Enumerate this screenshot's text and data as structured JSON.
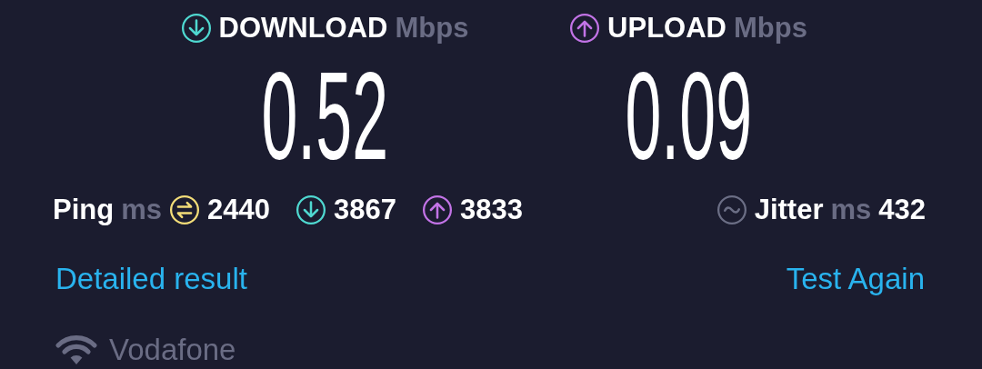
{
  "speeds": [
    {
      "kind": "download",
      "label": "DOWNLOAD",
      "unit": "Mbps",
      "value": "0.52"
    },
    {
      "kind": "upload",
      "label": "UPLOAD",
      "unit": "Mbps",
      "value": "0.09"
    }
  ],
  "ping": {
    "label": "Ping",
    "unit": "ms",
    "items": [
      {
        "kind": "ping",
        "value": "2440"
      },
      {
        "kind": "download",
        "value": "3867"
      },
      {
        "kind": "upload",
        "value": "3833"
      }
    ]
  },
  "jitter": {
    "label": "Jitter",
    "unit": "ms",
    "value": "432"
  },
  "links": [
    "Detailed result",
    "Test Again"
  ],
  "network": {
    "name": "Vodafone"
  }
}
